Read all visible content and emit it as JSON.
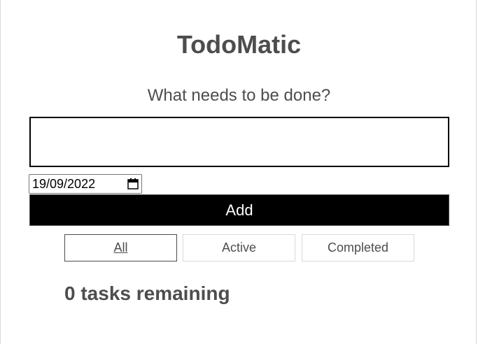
{
  "app": {
    "title": "TodoMatic"
  },
  "form": {
    "label": "What needs to be done?",
    "input_value": "",
    "date_value": "19/09/2022",
    "add_label": "Add"
  },
  "filters": {
    "all_label": "All",
    "active_label": "Active",
    "completed_label": "Completed",
    "selected": "All"
  },
  "list": {
    "heading": "0 tasks remaining"
  },
  "icons": {
    "date_picker": "calendar-icon"
  },
  "colors": {
    "text": "#4d4d4d",
    "add_button_bg": "#000000",
    "add_button_text": "#ffffff"
  }
}
